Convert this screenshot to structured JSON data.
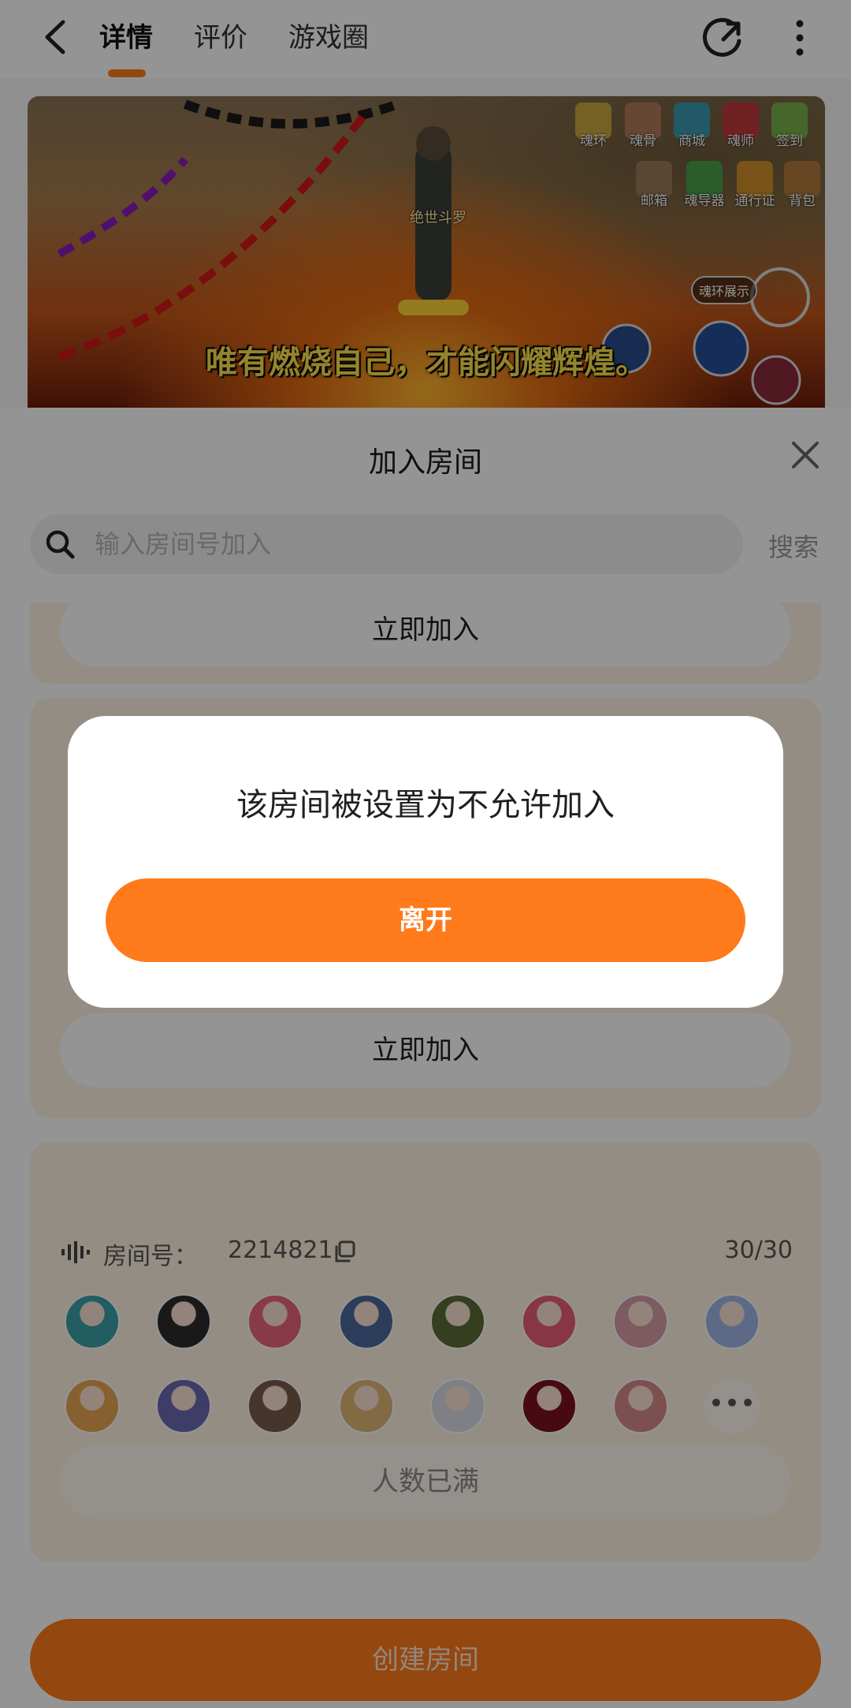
{
  "header": {
    "tabs": [
      {
        "label": "详情",
        "active": true
      },
      {
        "label": "评价",
        "active": false
      },
      {
        "label": "游戏圈",
        "active": false
      }
    ],
    "accent_color": "#ff7a1a"
  },
  "banner": {
    "caption": "唯有燃烧自己，才能闪耀辉煌。",
    "character_name": "绝世斗罗",
    "hud_labels": [
      "魂环",
      "魂骨",
      "商城",
      "魂师",
      "签到",
      "邮箱",
      "魂导器",
      "通行证",
      "背包"
    ],
    "tag_label": "魂环展示"
  },
  "join_sheet": {
    "title": "加入房间",
    "search": {
      "placeholder": "输入房间号加入",
      "value": "",
      "action_label": "搜索"
    },
    "cards": [
      {
        "join_label": "立即加入"
      },
      {
        "join_label": "立即加入"
      },
      {
        "room_id_label": "房间号：",
        "room_id": "2214821",
        "count": "30/30",
        "status_label": "人数已满",
        "avatar_colors": [
          "#3aa1a8",
          "#2b2b2b",
          "#e8647a",
          "#4b6a9b",
          "#5c6b34",
          "#e85d78",
          "#d79ea6",
          "#9fb6e8",
          "#e9a552",
          "#6a6ab2",
          "#7a5a4a",
          "#e0b873",
          "#d9dde6",
          "#7a1020",
          "#d88a8a"
        ]
      }
    ],
    "create_label": "创建房间"
  },
  "dialog": {
    "message": "该房间被设置为不允许加入",
    "button_label": "离开"
  }
}
